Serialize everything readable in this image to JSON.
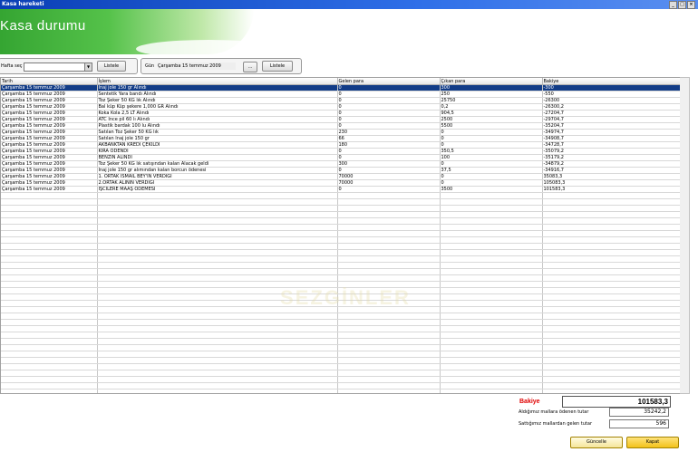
{
  "window": {
    "title": "Kasa hareketi",
    "controls": [
      "_",
      "□",
      "×"
    ]
  },
  "header": {
    "title": "Kasa durumu"
  },
  "filters": {
    "week_label": "Hafta seç",
    "week_value": "",
    "list_label": "Listele",
    "day_label": "Gün",
    "day_value": "Çarşamba 15 temmuz 2009",
    "picker_label": "...",
    "list2_label": "Listele"
  },
  "table": {
    "columns": [
      "Tarih",
      "İşlem",
      "Gelen para",
      "Çıkan para",
      "Bakiye"
    ],
    "rows": [
      [
        "Çarşamba 15 temmuz 2009",
        "İnaj jole 150 gr Alındı",
        "0",
        "300",
        "-300"
      ],
      [
        "Çarşamba 15 temmuz 2009",
        "Sentetik Yara bandı Alındı",
        "0",
        "250",
        "-550"
      ],
      [
        "Çarşamba 15 temmuz 2009",
        "Toz Şeker 50 KG lık Alındı",
        "0",
        "25750",
        "-26300"
      ],
      [
        "Çarşamba 15 temmuz 2009",
        "Bal küp Küp şekere 1,000 GR Alındı",
        "0",
        "0,2",
        "-26300,2"
      ],
      [
        "Çarşamba 15 temmuz 2009",
        "Koka Kola 2,5 LT Alındı",
        "0",
        "904,5",
        "-27204,7"
      ],
      [
        "Çarşamba 15 temmuz 2009",
        "ATC İnce pil 60 lı Alındı",
        "0",
        "2500",
        "-29704,7"
      ],
      [
        "Çarşamba 15 temmuz 2009",
        "Plastik bardak 100 lu Alındı",
        "0",
        "5500",
        "-35204,7"
      ],
      [
        "Çarşamba 15 temmuz 2009",
        "Satılan Toz Şeker 50 KG lık",
        "230",
        "0",
        "-34974,7"
      ],
      [
        "Çarşamba 15 temmuz 2009",
        "Satılan İnaj jole 150 gr",
        "66",
        "0",
        "-34908,7"
      ],
      [
        "Çarşamba 15 temmuz 2009",
        "AKBANKTAN KREDİ ÇEKİLDİ",
        "180",
        "0",
        "-34728,7"
      ],
      [
        "Çarşamba 15 temmuz 2009",
        "KİRA ÖDENDİ",
        "0",
        "350,5",
        "-35079,2"
      ],
      [
        "Çarşamba 15 temmuz 2009",
        "BENZİN ALINDI",
        "0",
        "100",
        "-35179,2"
      ],
      [
        "Çarşamba 15 temmuz 2009",
        "Toz Şeker 50 KG lık satışından kalan Alacak geldi",
        "300",
        "0",
        "-34879,2"
      ],
      [
        "Çarşamba 15 temmuz 2009",
        "İnaj jole 150 gr alımından kalan borcun ödenesi",
        "0",
        "37,5",
        "-34916,7"
      ],
      [
        "Çarşamba 15 temmuz 2009",
        "1. ORTAK İSMAİL BEY'İN VERDİĞİ",
        "70000",
        "0",
        "35083,3"
      ],
      [
        "Çarşamba 15 temmuz 2009",
        "2.ORTAK ALİNİN VERDİĞİ",
        "70000",
        "0",
        "105083,3"
      ],
      [
        "Çarşamba 15 temmuz 2009",
        "İŞCİLERE MAAŞ ÖDEMESİ",
        "0",
        "3500",
        "101583,3"
      ]
    ]
  },
  "watermark": "SEZGİNLER",
  "summary": {
    "balance_label": "Bakiye",
    "balance_value": "101583,3",
    "paid_label": "Aldığımız mallara ödenen tutar",
    "paid_value": "35242,2",
    "received_label": "Sattığımız mallardan gelen tutar",
    "received_value": "596"
  },
  "buttons": {
    "refresh": "Güncelle",
    "close": "Kapat"
  }
}
